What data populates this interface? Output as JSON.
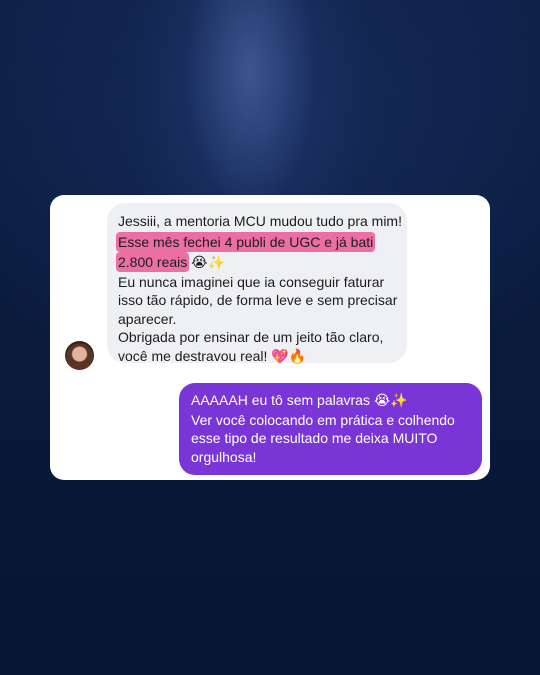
{
  "chat": {
    "incoming": {
      "line1": "Jessiii, a mentoria MCU mudou tudo pra mim!",
      "highlight_line1": "Esse mês fechei 4 publi de UGC e já bati",
      "highlight_line2": "2.800 reais",
      "emoji_line2": "😭✨",
      "line3": "Eu nunca imaginei que ia conseguir faturar",
      "line4": "isso tão rápido, de forma leve e sem precisar",
      "line5": "aparecer.",
      "line6": "Obrigada por ensinar de um jeito tão claro,",
      "line7": "você me destravou real!",
      "emoji_line7": "💖🔥"
    },
    "outgoing": {
      "line1": "AAAAAH eu tô sem palavras",
      "emoji_line1": "😭✨",
      "line2": "Ver você colocando em prática e colhendo",
      "line3": "esse tipo de resultado me deixa MUITO",
      "line4": "orgulhosa!"
    }
  },
  "colors": {
    "background": "#071633",
    "incoming_bubble": "#eff0f3",
    "outgoing_bubble": "#7a35d6",
    "highlight": "#ec6fa4"
  }
}
